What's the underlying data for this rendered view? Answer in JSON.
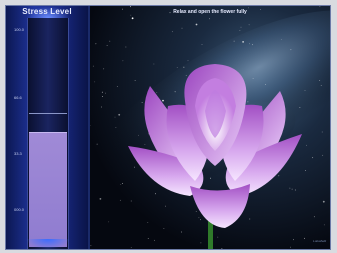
{
  "stress_panel": {
    "title": "Stress Level",
    "tick_labels": [
      "100.0",
      "66.6",
      "33.3",
      "000.0"
    ],
    "level_fraction": 0.5,
    "marker_fraction": 0.58
  },
  "scene": {
    "instruction": "Relax and open the flower fully",
    "watermark": "Lotusfield"
  },
  "colors": {
    "petal": "#b06ad0",
    "petal_light": "#f0d8ff",
    "fill": "#9a86d4",
    "background": "#0b1030"
  },
  "icons": [
    "lotus-flower-image",
    "starfield-background"
  ]
}
